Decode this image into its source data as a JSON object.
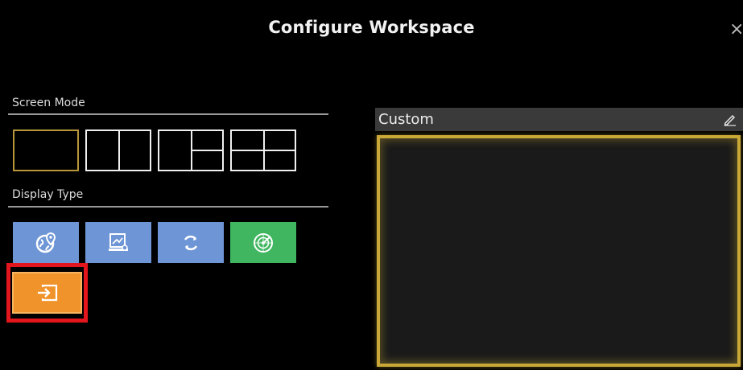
{
  "dialog": {
    "title": "Configure Workspace",
    "close_glyph": "×"
  },
  "screen_mode": {
    "label": "Screen Mode",
    "options": [
      {
        "name": "single",
        "selected": true
      },
      {
        "name": "two-vertical",
        "selected": false
      },
      {
        "name": "one-plus-two",
        "selected": false
      },
      {
        "name": "quad",
        "selected": false
      }
    ]
  },
  "display_type": {
    "label": "Display Type",
    "options": [
      {
        "icon": "globe-pin-icon",
        "color": "#6e95d6"
      },
      {
        "icon": "chart-display-icon",
        "color": "#6e95d6"
      },
      {
        "icon": "refresh-icon",
        "color": "#6e95d6"
      },
      {
        "icon": "radar-icon",
        "color": "#3fb65f"
      },
      {
        "icon": "input-source-icon",
        "color": "#f0932b",
        "highlighted": true
      }
    ]
  },
  "preview": {
    "label": "Custom",
    "edit_icon": "pencil-icon",
    "border_color": "#c9a837"
  }
}
